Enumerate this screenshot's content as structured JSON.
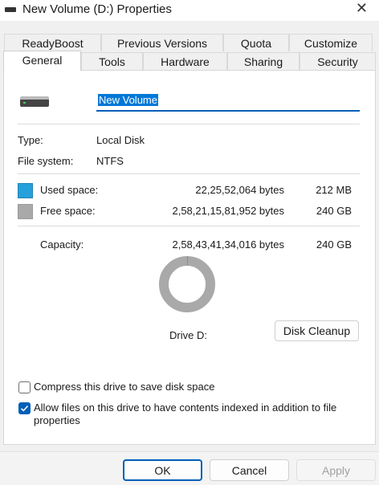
{
  "window": {
    "title": "New Volume (D:) Properties",
    "close_glyph": "✕",
    "title_icon": "drive-icon"
  },
  "tabs_back": [
    "ReadyBoost",
    "Previous Versions",
    "Quota",
    "Customize"
  ],
  "tabs_front": [
    "General",
    "Tools",
    "Hardware",
    "Sharing",
    "Security"
  ],
  "active_tab": "General",
  "general": {
    "volume_name": "New Volume",
    "type_label": "Type:",
    "type_value": "Local Disk",
    "fs_label": "File system:",
    "fs_value": "NTFS",
    "used_label": "Used space:",
    "used_bytes": "22,25,52,064 bytes",
    "used_size": "212 MB",
    "free_label": "Free space:",
    "free_bytes": "2,58,21,15,81,952 bytes",
    "free_size": "240 GB",
    "capacity_label": "Capacity:",
    "capacity_bytes": "2,58,43,41,34,016 bytes",
    "capacity_size": "240 GB",
    "drive_label": "Drive D:",
    "cleanup_button": "Disk Cleanup",
    "used_fraction": 0.00086,
    "compress_label": "Compress this drive to save disk space",
    "compress_checked": false,
    "index_label_line1": "Allow files on this drive to have contents indexed in addition to file",
    "index_label_line2": "properties",
    "index_checked": true
  },
  "colors": {
    "used": "#26a0da",
    "free": "#a9a9a9",
    "accent": "#005fb8"
  },
  "footer": {
    "ok": "OK",
    "cancel": "Cancel",
    "apply": "Apply"
  }
}
